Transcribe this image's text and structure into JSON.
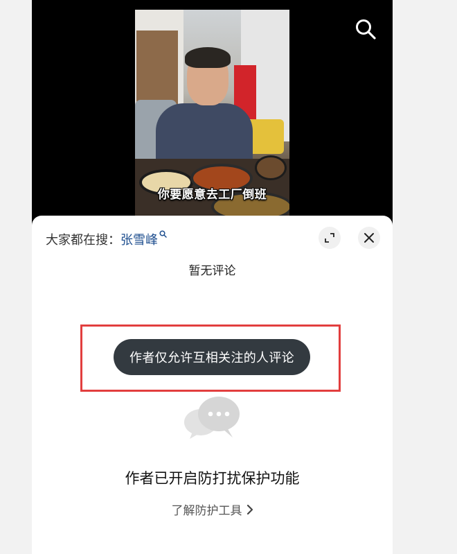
{
  "video": {
    "subtitle": "你要愿意去工厂倒班"
  },
  "sheet": {
    "hot_search_prefix": "大家都在搜：",
    "hot_search_term": "张雪峰",
    "no_comment_label": "暂无评论",
    "toast_message": "作者仅允许互相关注的人评论",
    "protection_title": "作者已开启防打扰保护功能",
    "learn_more_label": "了解防护工具"
  },
  "colors": {
    "highlight_border": "#e23e3e",
    "toast_bg": "#333a40",
    "hot_search_term": "#1f4f8f"
  },
  "icons": {
    "search": "search-icon",
    "hot_search": "search-small-icon",
    "expand": "expand-icon",
    "close": "close-icon",
    "chat": "chat-bubbles-icon",
    "chevron": "chevron-right-icon"
  }
}
